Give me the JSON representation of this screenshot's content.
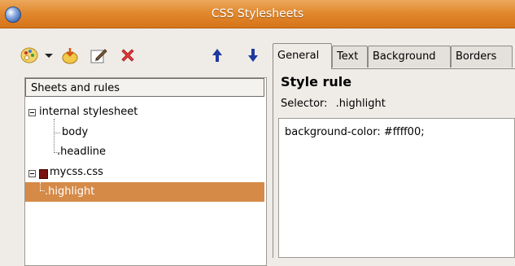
{
  "window": {
    "title": "CSS Stylesheets"
  },
  "toolbar": {
    "buttons": [
      {
        "icon": "palette-icon",
        "label": ""
      },
      {
        "icon": "chevron-down-icon",
        "label": ""
      },
      {
        "icon": "add-rule-icon",
        "label": ""
      },
      {
        "icon": "edit-icon",
        "label": ""
      },
      {
        "icon": "delete-icon",
        "label": ""
      },
      {
        "icon": "arrow-up-icon",
        "label": ""
      },
      {
        "icon": "arrow-down-icon",
        "label": ""
      }
    ]
  },
  "tree": {
    "header": "Sheets and rules",
    "nodes": [
      {
        "label": "internal stylesheet"
      },
      {
        "label": "body"
      },
      {
        "label": ".headline"
      },
      {
        "label": "mycss.css"
      },
      {
        "label": ".highlight"
      }
    ]
  },
  "tabs": [
    "General",
    "Text",
    "Background",
    "Borders"
  ],
  "general": {
    "heading": "Style rule",
    "selector_label": "Selector:",
    "selector_value": ".highlight",
    "rule_text": "background-color: #ffff00;"
  },
  "colors": {
    "accent": "#d58a48",
    "title_bar": "#e2892f"
  }
}
